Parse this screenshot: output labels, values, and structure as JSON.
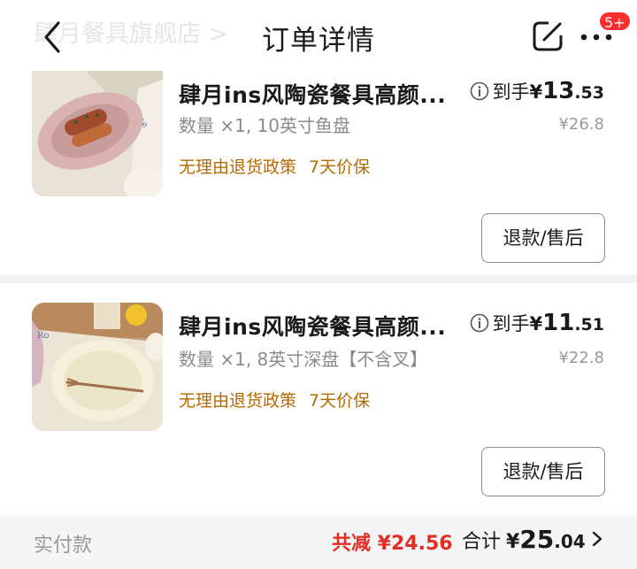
{
  "header": {
    "store_ghost": "肆月餐具旗舰店 >",
    "title": "订单详情",
    "badge": "5+"
  },
  "items": [
    {
      "title": "肆月ins风陶瓷餐具高颜...",
      "spec": "数量 ×1, 10英寸鱼盘",
      "tags": [
        "无理由退货政策",
        "7天价保"
      ],
      "price_label": "到手",
      "price_symbol": "¥",
      "price_int": "13",
      "price_dec": ".53",
      "original_price": "¥26.8",
      "button": "退款/售后"
    },
    {
      "title": "肆月ins风陶瓷餐具高颜...",
      "spec": "数量 ×1, 8英寸深盘【不含叉】",
      "tags": [
        "无理由退货政策",
        "7天价保"
      ],
      "price_label": "到手",
      "price_symbol": "¥",
      "price_int": "11",
      "price_dec": ".51",
      "original_price": "¥22.8",
      "button": "退款/售后"
    }
  ],
  "footer": {
    "paid_label": "实付款",
    "savings": "共减 ¥24.56",
    "total_label": "合计",
    "total_symbol": "¥",
    "total_int": "25",
    "total_dec": ".04"
  },
  "colors": {
    "accent_red": "#e02e24",
    "tag_orange": "#b56a00",
    "badge_red": "#ff2d2d"
  },
  "icons": [
    "back-arrow-icon",
    "share-icon",
    "more-icon",
    "info-icon",
    "chevron-right-icon"
  ]
}
